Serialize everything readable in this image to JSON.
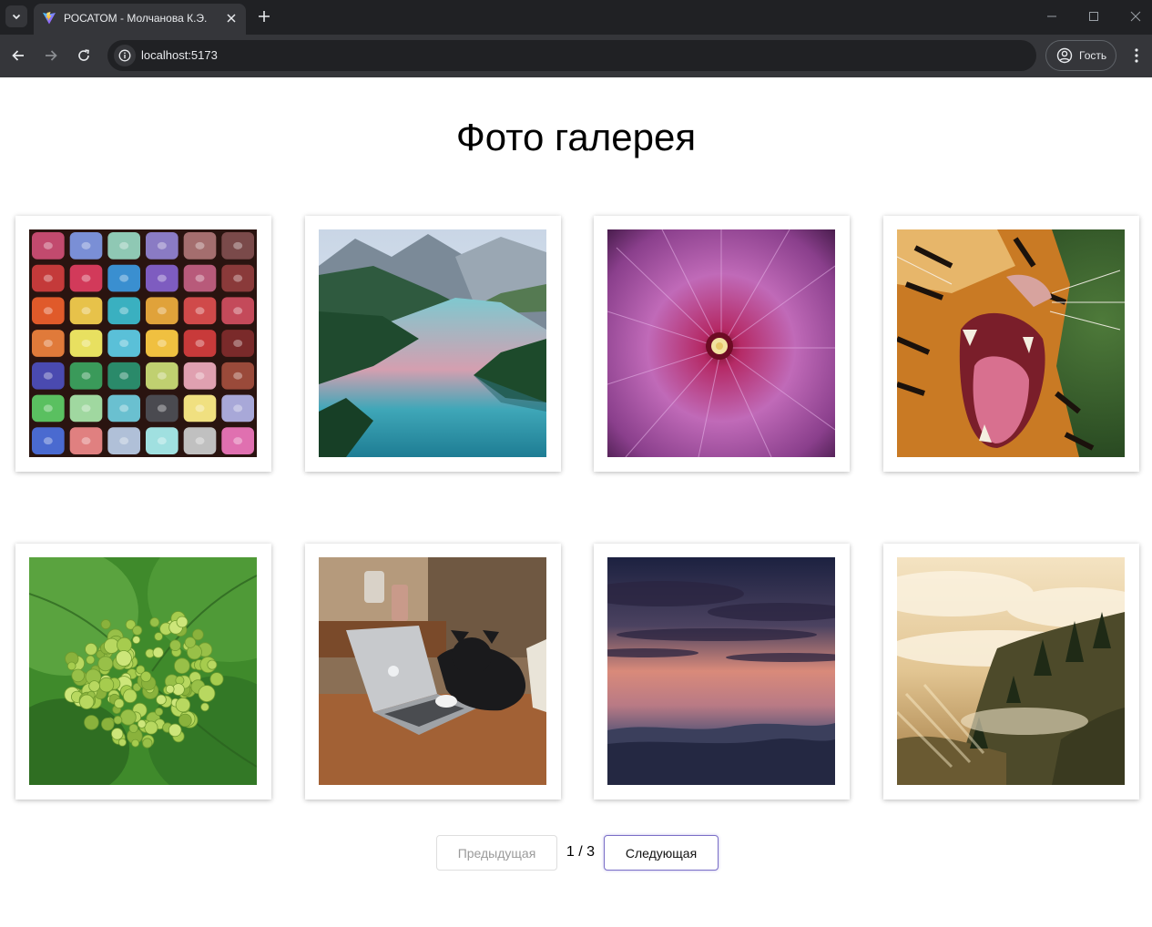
{
  "browser": {
    "tab": {
      "title": "РОСАТОМ - Молчанова К.Э."
    },
    "address_bar": {
      "url": "localhost:5173"
    },
    "profile": {
      "label": "Гость"
    },
    "icons": {
      "tab_search": "chevron-down-icon",
      "favicon": "vite-logo-icon",
      "tab_close": "close-icon",
      "new_tab": "plus-icon",
      "minimize": "minimize-icon",
      "maximize": "maximize-icon",
      "window_close": "close-icon",
      "back": "arrow-left-icon",
      "forward": "arrow-right-icon",
      "reload": "reload-icon",
      "site_info": "info-icon",
      "profile": "account-circle-icon",
      "menu": "more-vert-icon"
    }
  },
  "gallery": {
    "title": "Фото галерея",
    "photos": [
      {
        "subject": "pastel-chalks"
      },
      {
        "subject": "mountain-lake"
      },
      {
        "subject": "pink-hibiscus"
      },
      {
        "subject": "roaring-tiger"
      },
      {
        "subject": "green-flower-bud"
      },
      {
        "subject": "cat-on-laptop"
      },
      {
        "subject": "sunset-sky"
      },
      {
        "subject": "foggy-forest"
      }
    ]
  },
  "pagination": {
    "prev_label": "Предыдущая",
    "next_label": "Следующая",
    "current_page": 1,
    "total_pages": 3,
    "indicator": "1 / 3"
  },
  "colors": {
    "chrome_dark": "#202124",
    "chrome_tab": "#35363a",
    "next_border": "#7a6fc7"
  }
}
